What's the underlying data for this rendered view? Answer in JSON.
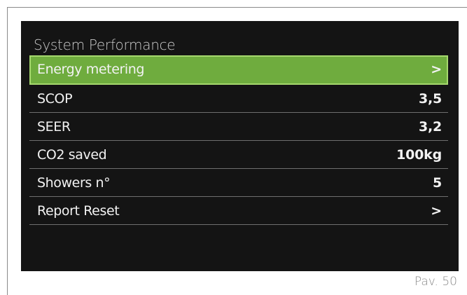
{
  "screen": {
    "title": "System Performance",
    "menu_items": [
      {
        "label": "Energy metering",
        "value": ">",
        "selected": true
      },
      {
        "label": "SCOP",
        "value": "3,5",
        "selected": false
      },
      {
        "label": "SEER",
        "value": "3,2",
        "selected": false
      },
      {
        "label": "CO2 saved",
        "value": "100kg",
        "selected": false
      },
      {
        "label": "Showers n°",
        "value": "5",
        "selected": false
      },
      {
        "label": "Report Reset",
        "value": ">",
        "selected": false
      }
    ]
  },
  "page_label": "Pav. 50",
  "colors": {
    "screen_background": "#141414",
    "selected_row": "#6fac3e",
    "selected_border": "#a6d86e",
    "text": "#f2f2f2",
    "title_text": "#c9c9c9"
  }
}
